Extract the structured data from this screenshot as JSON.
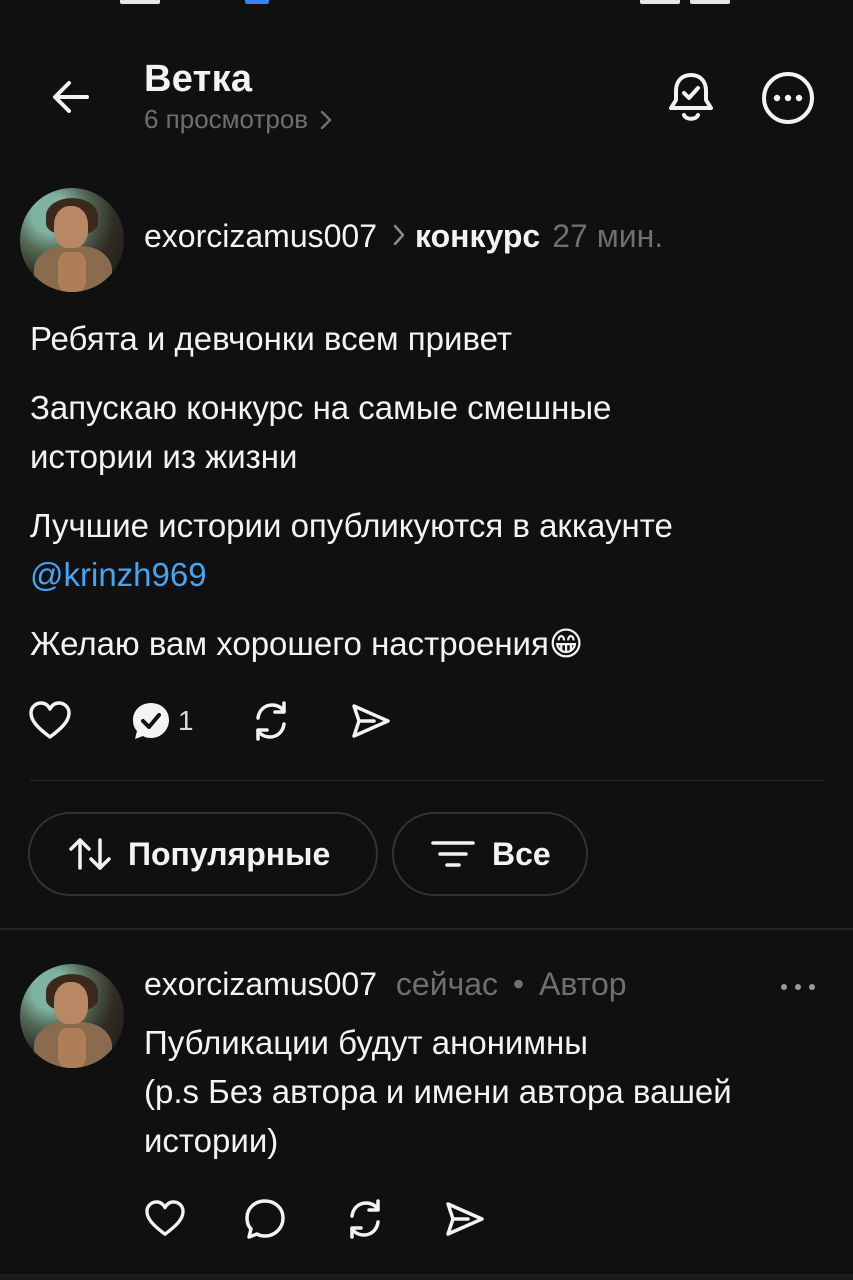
{
  "header": {
    "title": "Ветка",
    "views": "6 просмотров"
  },
  "post": {
    "username": "exorcizamus007",
    "topic": "конкурс",
    "time": "27 мин.",
    "paragraphs": [
      "Ребята и девчонки всем привет",
      "Запускаю конкурс на самые смешные истории из жизни",
      "Лучшие истории опубликуются в аккаунте"
    ],
    "mention": "@krinzh969",
    "closing": "Желаю вам хорошего настроения😁",
    "reply_count": "1"
  },
  "filters": {
    "sort_label": "Популярные",
    "filter_label": "Все"
  },
  "comment": {
    "username": "exorcizamus007",
    "time": "сейчас",
    "separator": "•",
    "author_badge": "Автор",
    "lines": [
      "Публикации будут анонимны",
      "(p.s Без автора и имени автора вашей",
      "истории)"
    ]
  },
  "colors": {
    "background": "#101010",
    "text": "#f3f3f3",
    "muted": "#6f6f6f",
    "mention": "#4aa3f0"
  }
}
